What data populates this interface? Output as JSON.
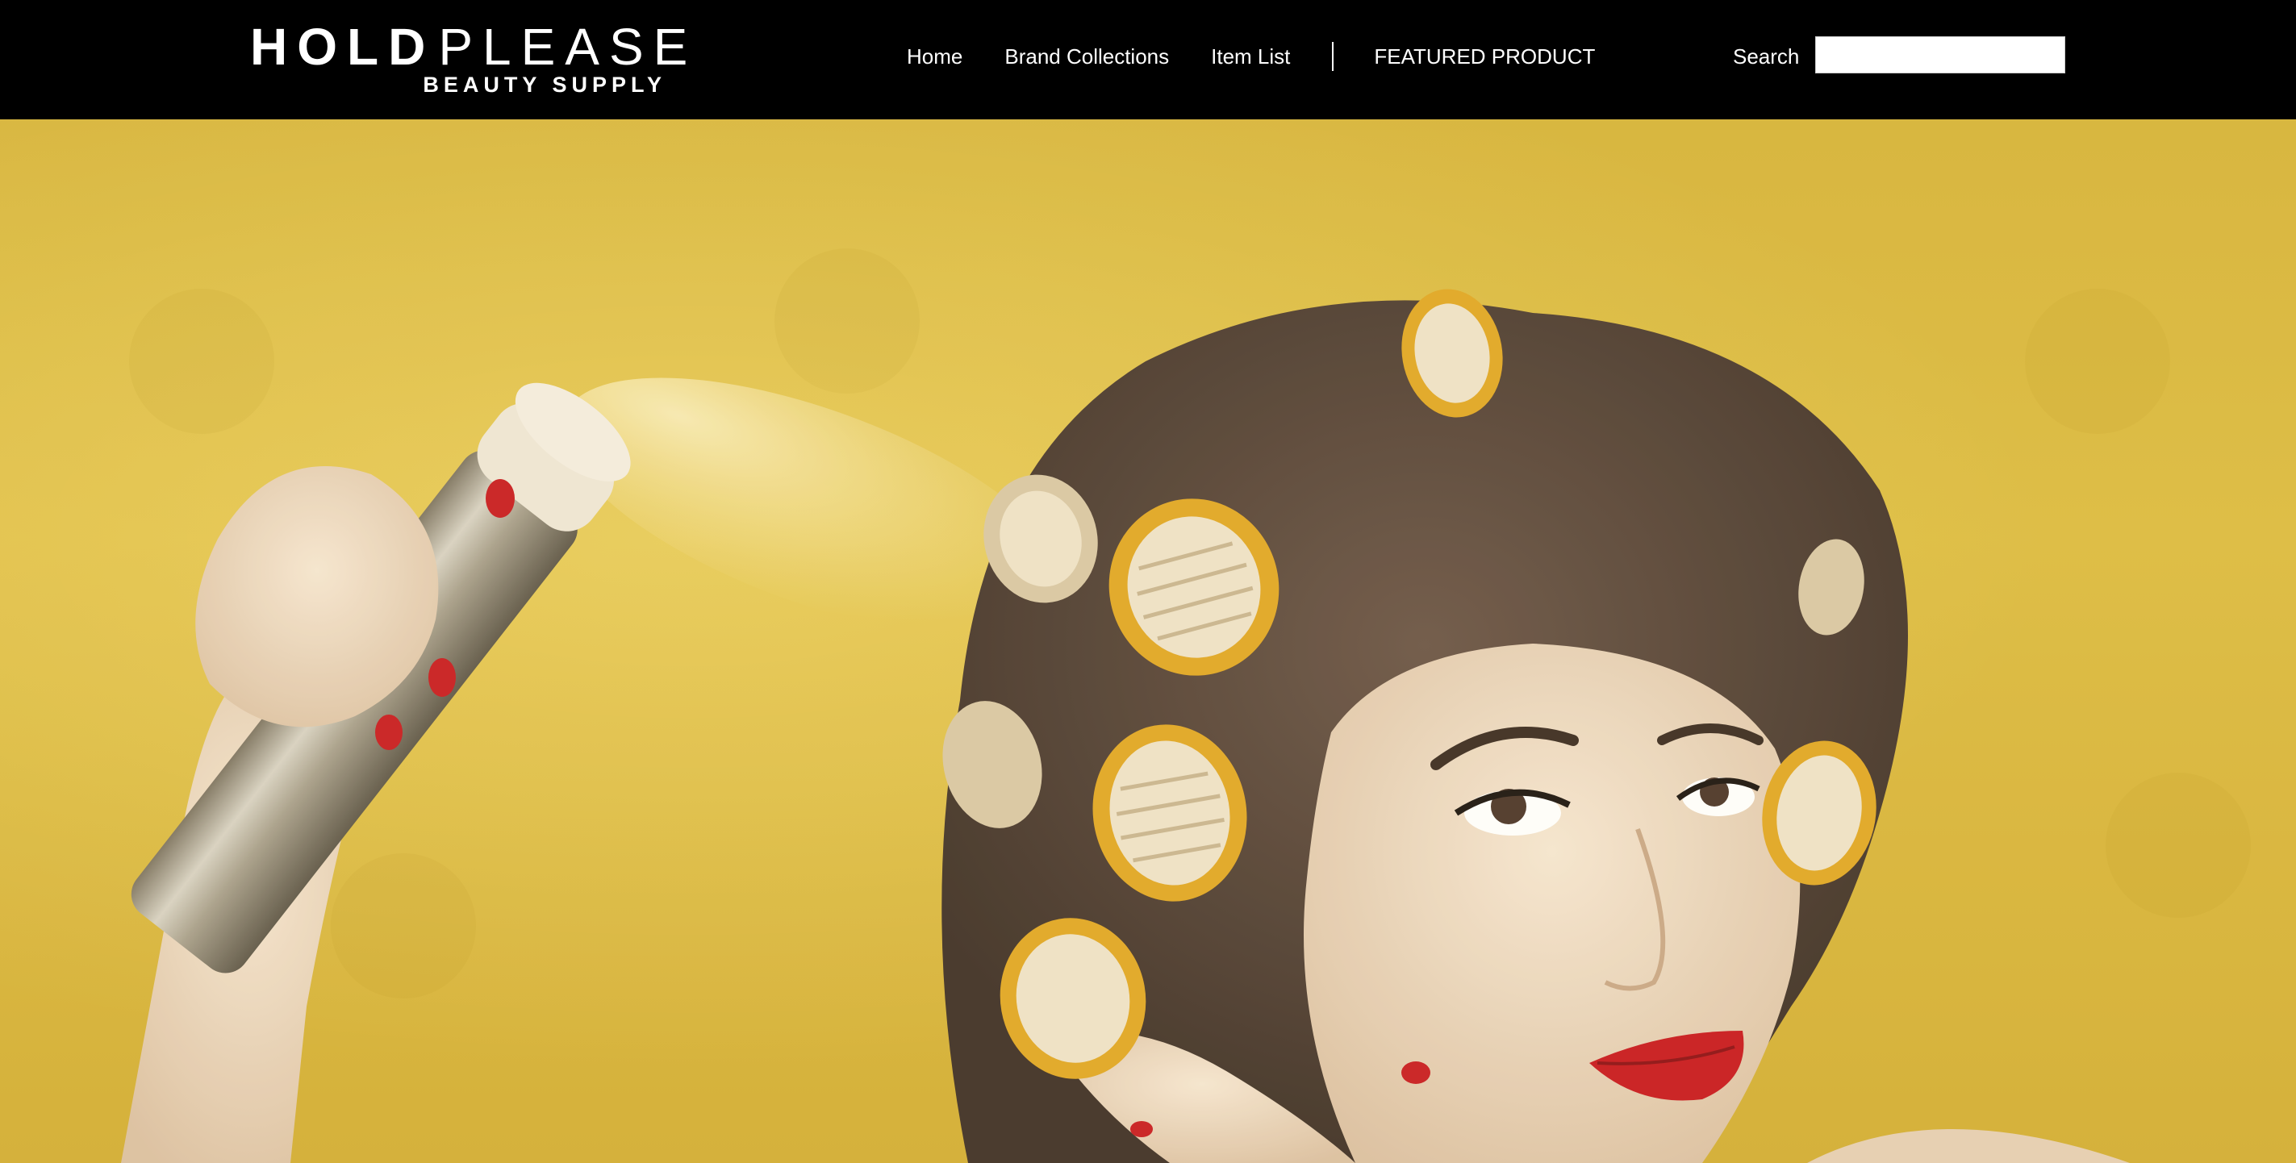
{
  "brand": {
    "name_bold": "HOLD",
    "name_light": "PLEASE",
    "tagline": "BEAUTY SUPPLY"
  },
  "nav": {
    "home": "Home",
    "brand_collections": "Brand Collections",
    "item_list": "Item List",
    "featured": "FEATURED PRODUCT"
  },
  "search": {
    "label": "Search",
    "value": "",
    "placeholder": ""
  },
  "hero": {
    "image": "woman-in-hair-rollers-spraying-hairspray-photo"
  },
  "colors": {
    "header_bg": "#000000",
    "header_text": "#ffffff",
    "hero_bg": "#d9b63c"
  }
}
